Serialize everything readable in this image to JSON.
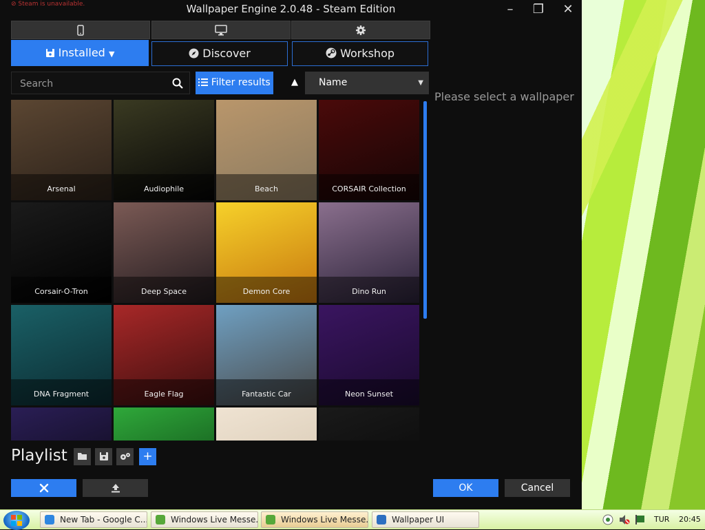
{
  "window": {
    "title": "Wallpaper Engine 2.0.48 - Steam Edition",
    "warning": "Steam is unavailable."
  },
  "window_controls": {
    "minimize": "–",
    "maximize": "❐",
    "close": "✕"
  },
  "device_tabs": [
    {
      "icon": "phone-icon"
    },
    {
      "icon": "monitor-icon"
    },
    {
      "icon": "gear-icon"
    }
  ],
  "nav_tabs": [
    {
      "label": "Installed",
      "icon": "save-icon",
      "active": true
    },
    {
      "label": "Discover",
      "icon": "compass-icon"
    },
    {
      "label": "Workshop",
      "icon": "steam-icon"
    }
  ],
  "search": {
    "placeholder": "Search"
  },
  "filter": {
    "label": "Filter results"
  },
  "sort": {
    "value": "Name",
    "direction": "asc"
  },
  "wallpapers": [
    {
      "name": "Arsenal",
      "colors": [
        "#5b4632",
        "#2b2119"
      ]
    },
    {
      "name": "Audiophile",
      "colors": [
        "#3a3a22",
        "#050505"
      ]
    },
    {
      "name": "Beach",
      "colors": [
        "#b9966b",
        "#8a7a60"
      ]
    },
    {
      "name": "CORSAIR Collection",
      "colors": [
        "#4a0a0a",
        "#150505"
      ]
    },
    {
      "name": "Corsair-O-Tron",
      "colors": [
        "#1b1b1b",
        "#000000"
      ]
    },
    {
      "name": "Deep Space",
      "colors": [
        "#7b5a55",
        "#221b1f"
      ]
    },
    {
      "name": "Demon Core",
      "colors": [
        "#f6d12a",
        "#c7770f"
      ]
    },
    {
      "name": "Dino Run",
      "colors": [
        "#8a6f8d",
        "#2a2238"
      ]
    },
    {
      "name": "DNA Fragment",
      "colors": [
        "#1a6066",
        "#0b2a30"
      ]
    },
    {
      "name": "Eagle Flag",
      "colors": [
        "#a82828",
        "#3c0e0e"
      ]
    },
    {
      "name": "Fantastic Car",
      "colors": [
        "#6fa0c2",
        "#4a4a4a"
      ]
    },
    {
      "name": "Neon Sunset",
      "colors": [
        "#3a1560",
        "#1a0a2e"
      ]
    },
    {
      "name": "",
      "colors": [
        "#2a1e55",
        "#08060f"
      ]
    },
    {
      "name": "",
      "colors": [
        "#2fa83a",
        "#0b3d12"
      ]
    },
    {
      "name": "",
      "colors": [
        "#efe3d2",
        "#d2c3ad"
      ]
    },
    {
      "name": "",
      "colors": [
        "#1a1a1a",
        "#050505"
      ]
    }
  ],
  "detail": {
    "placeholder": "Please select a wallpaper"
  },
  "playlist": {
    "label": "Playlist"
  },
  "buttons": {
    "ok": "OK",
    "cancel": "Cancel"
  },
  "taskbar": {
    "items": [
      {
        "label": "New Tab - Google C...",
        "icon_color": "#2f86e0"
      },
      {
        "label": "Windows Live Messe...",
        "icon_color": "#57a83a"
      },
      {
        "label": "Windows Live Messe...",
        "icon_color": "#57a83a",
        "active": true
      },
      {
        "label": "Wallpaper UI",
        "icon_color": "#2d6fc0"
      }
    ],
    "language": "TUR",
    "clock": "20:45"
  },
  "colors": {
    "accent": "#2d7df0",
    "app_bg": "#0e0e0e"
  }
}
